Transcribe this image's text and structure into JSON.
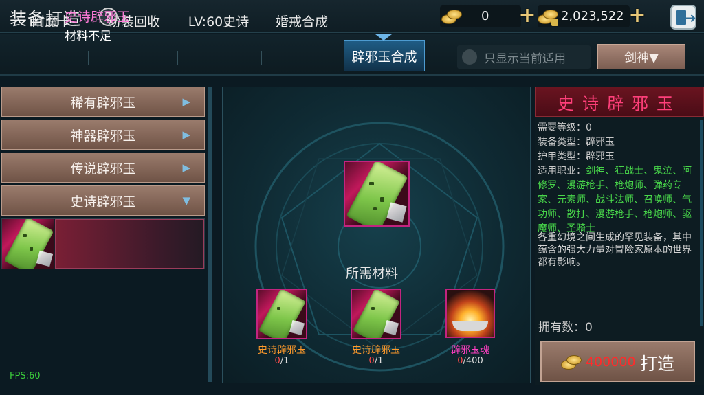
{
  "header": {
    "title": "装备打造",
    "help_icon": "?",
    "gold_amount": "0",
    "bound_gold_amount": "2,023,522",
    "exit_icon": "exit-door-icon"
  },
  "tabs": [
    {
      "label": "附魔卡",
      "active": false
    },
    {
      "label": "粉装回收",
      "active": false
    },
    {
      "label": "LV:60史诗",
      "active": false
    },
    {
      "label": "婚戒合成",
      "active": false
    },
    {
      "label": "辟邪玉合成",
      "active": true
    }
  ],
  "filter": {
    "show_current_label": "只显示当前适用",
    "class_select": "剑神▼"
  },
  "categories": [
    {
      "label": "稀有辟邪玉",
      "arrow": "▶"
    },
    {
      "label": "神器辟邪玉",
      "arrow": "▶"
    },
    {
      "label": "传说辟邪玉",
      "arrow": "▶"
    },
    {
      "label": "史诗辟邪玉",
      "arrow": "▼"
    }
  ],
  "selected_item": {
    "name": "史诗辟邪玉",
    "status": "材料不足"
  },
  "center": {
    "required_label": "所需材料",
    "materials": [
      {
        "name": "史诗辟邪玉",
        "have": "0",
        "need": "/1",
        "color": "#ff9a2b"
      },
      {
        "name": "史诗辟邪玉",
        "have": "0",
        "need": "/1",
        "color": "#ff9a2b"
      },
      {
        "name": "辟邪玉魂",
        "have": "0",
        "need": "/400",
        "color": "#ff3fc2"
      }
    ]
  },
  "info": {
    "title": "史诗辟邪玉",
    "req_level_label": "需要等级：",
    "req_level": "0",
    "equip_type_label": "装备类型：",
    "equip_type": "辟邪玉",
    "armor_type_label": "护甲类型：",
    "armor_type": "辟邪玉",
    "classes_label": "适用职业：",
    "classes": "剑神、狂战士、鬼泣、阿修罗、漫游枪手、枪炮师、弹药专家、元素师、战斗法师、召唤师、气功师、散打、漫游枪手、枪炮师、驱魔师、圣骑士",
    "description": "各重幻境之间生成的罕见装备，其中蕴含的强大力量对冒险家原本的世界都有影响。",
    "owned_label": "拥有数：",
    "owned": "0",
    "craft_cost": "400000",
    "craft_label": "打造"
  },
  "fps": "FPS:60"
}
